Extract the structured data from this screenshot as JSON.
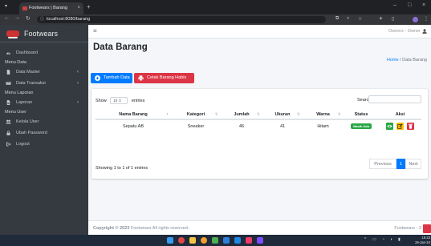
{
  "browser": {
    "tab_title": "Footwears | Barang",
    "tab_close": "×",
    "new_tab": "+",
    "window_controls": [
      "–",
      "□",
      "×"
    ],
    "url": "localhost:8080/barang"
  },
  "sidebar": {
    "brand": "Footwears",
    "items": [
      {
        "type": "link",
        "label": "Dashboard",
        "icon": "tachometer-icon"
      },
      {
        "type": "header",
        "label": "Menu Data"
      },
      {
        "type": "link",
        "label": "Data Master",
        "icon": "file-icon",
        "caret": "‹"
      },
      {
        "type": "link",
        "label": "Data Transaksi",
        "icon": "keyboard-icon",
        "caret": "‹"
      },
      {
        "type": "header",
        "label": "Menu Laporan"
      },
      {
        "type": "link",
        "label": "Laporan",
        "icon": "report-icon",
        "caret": "‹"
      },
      {
        "type": "header",
        "label": "Menu User"
      },
      {
        "type": "link",
        "label": "Kelola User",
        "icon": "users-icon"
      },
      {
        "type": "link",
        "label": "Ubah Password",
        "icon": "lock-icon"
      },
      {
        "type": "link",
        "label": "Logout",
        "icon": "sign-out-icon"
      }
    ]
  },
  "topnav": {
    "hamburger": "≡",
    "user": "Owners - Owner"
  },
  "page": {
    "title": "Data Barang",
    "breadcrumb_home": "Home",
    "breadcrumb_sep": "/",
    "breadcrumb_current": "Data Barang"
  },
  "actions": {
    "add": "Tambah Data",
    "print": "Cetak Barang Habis"
  },
  "datatable": {
    "show": "Show",
    "entries_value": "10",
    "entries": "entries",
    "search_label": "Search:",
    "columns": [
      "Nama Barang",
      "Kategori",
      "Jumlah",
      "Ukuran",
      "Warna",
      "Status",
      "Aksi"
    ],
    "rows": [
      {
        "nama": "Sepatu AB",
        "kategori": "Sneaker",
        "jumlah": "46",
        "ukuran": "41",
        "warna": "Hitam",
        "status": "Masih Ada"
      }
    ],
    "info": "Showing 1 to 1 of 1 entries",
    "previous": "Previous",
    "page": "1",
    "next": "Next"
  },
  "footer": {
    "copyright_label": "Copyright © 2023",
    "brand": "Footwears",
    "rights": "All rights reserved.",
    "right_text": "Footwears - 2"
  },
  "taskbar": {
    "time": "15:23",
    "date": "26-Jan-24"
  },
  "colors": {
    "primary": "#007bff",
    "danger": "#dc3545",
    "success": "#28a745",
    "warning": "#ffc107",
    "sidebar": "#343a40"
  }
}
